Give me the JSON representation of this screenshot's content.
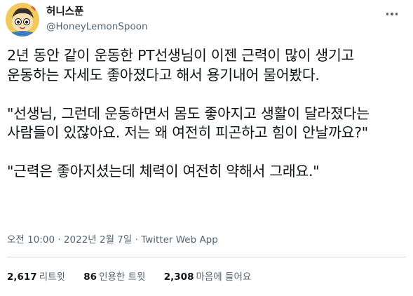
{
  "user": {
    "display_name": "허니스푼",
    "handle": "@HoneyLemonSpoon"
  },
  "tweet": {
    "text": "2년 동안 같이 운동한 PT선생님이 이젠 근력이 많이 생기고 운동하는 자세도 좋아졌다고 해서 용기내어 물어봤다.\n\n\"선생님, 그런데 운동하면서 몸도 좋아지고 생활이 달라졌다는 사람들이 있잖아요. 저는 왜 여전히 피곤하고 힘이 안날까요?\"\n\n\"근력은 좋아지셨는데 체력이 여전히 약해서 그래요.\""
  },
  "meta": {
    "time": "오전 10:00",
    "sep1": " · ",
    "date": "2022년 2월 7일",
    "sep2": " · ",
    "source": "Twitter Web App"
  },
  "stats": {
    "retweets_count": "2,617",
    "retweets_label": "리트윗",
    "quotes_count": "86",
    "quotes_label": "인용한 트윗",
    "likes_count": "2,308",
    "likes_label": "마음에 들어요"
  },
  "icons": {
    "more": "more-horizontal-icon"
  }
}
